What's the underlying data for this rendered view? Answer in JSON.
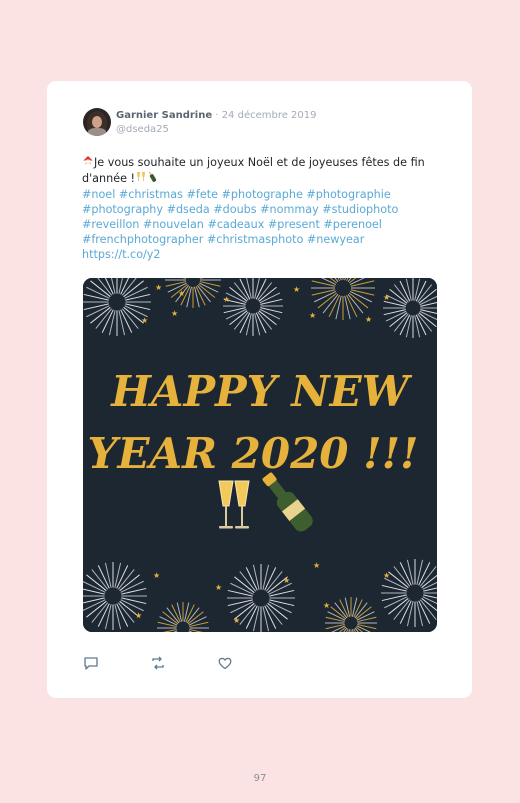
{
  "tweet": {
    "author_name": "Garnier Sandrine",
    "date_separator": "·",
    "date": "24 décembre 2019",
    "handle": "@dseda25",
    "text_line": "Je vous souhaite un joyeux Noël et de joyeuses fêtes de fin d'année !",
    "hashtags": "#noel #christmas #fete #photographe #photographie #photography #dseda #doubs #nommay #studiophoto #reveillon #nouvelan #cadeaux #present #perenoel #frenchphotographer #christmasphoto #newyear",
    "link": "https://t.co/y2",
    "image_text_line1": "HAPPY NEW",
    "image_text_line2": "YEAR 2020 !!!"
  },
  "icons": {
    "reply": "reply-icon",
    "retweet": "retweet-icon",
    "like": "heart-icon"
  },
  "colors": {
    "page_bg": "#fbe3e4",
    "card_bg": "#ffffff",
    "link": "#5aa9d6",
    "image_bg": "#1d2732",
    "gold": "#e7b23b"
  },
  "page_number": "97"
}
